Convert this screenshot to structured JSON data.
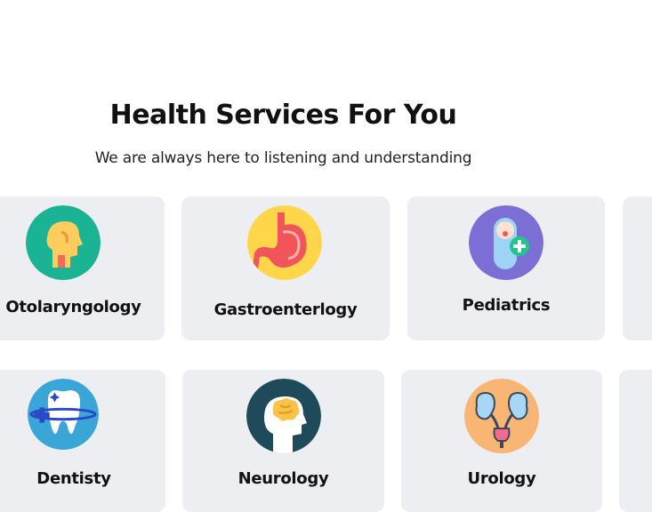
{
  "header": {
    "title": "Health Services For You",
    "subtitle": "We are always here to listening and understanding"
  },
  "services": [
    {
      "label": "Otolaryngology",
      "icon": "throat-icon",
      "color": "#1ab394"
    },
    {
      "label": "Gastroenterlogy",
      "icon": "stomach-icon",
      "color": "#ffd54a"
    },
    {
      "label": "Pediatrics",
      "icon": "baby-icon",
      "color": "#7b6fd6"
    },
    {
      "label": "Dentisty",
      "icon": "tooth-icon",
      "color": "#3aa6d8"
    },
    {
      "label": "Neurology",
      "icon": "brain-icon",
      "color": "#1f4a5c"
    },
    {
      "label": "Urology",
      "icon": "kidney-icon",
      "color": "#f8b574"
    }
  ],
  "colors": {
    "card_background": "#edeef2",
    "text": "#111111"
  }
}
